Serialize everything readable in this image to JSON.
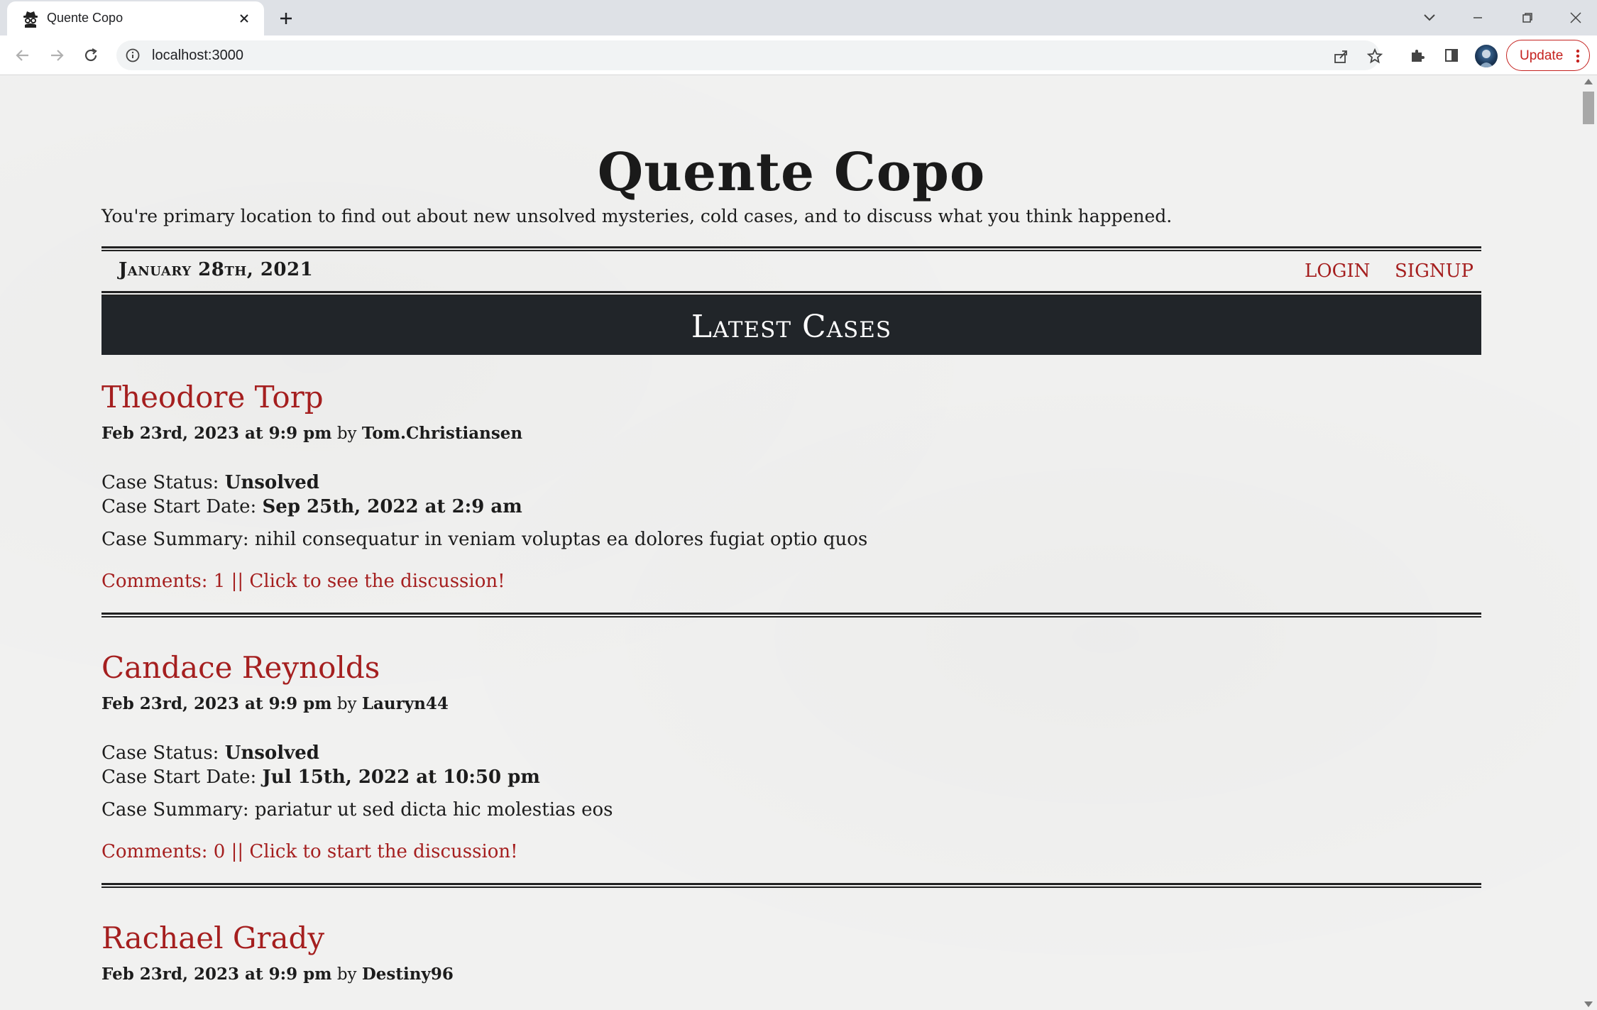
{
  "browser": {
    "tab_title": "Quente Copo",
    "url": "localhost:3000",
    "update_label": "Update"
  },
  "site": {
    "title": "Quente Copo",
    "tagline": "You're primary location to find out about new unsolved mysteries, cold cases, and to discuss what you think happened.",
    "date": "January 28th, 2021",
    "nav": {
      "login": "LOGIN",
      "signup": "SIGNUP"
    },
    "section_title": "Latest Cases"
  },
  "labels": {
    "by": "by",
    "status": "Case Status:",
    "start_date": "Case Start Date:",
    "summary": "Case Summary:"
  },
  "cases": [
    {
      "title": "Theodore Torp",
      "posted": "Feb 23rd, 2023 at 9:9 pm",
      "author": "Tom.Christiansen",
      "status": "Unsolved",
      "start_date": "Sep 25th, 2022 at 2:9 am",
      "summary": "nihil consequatur in veniam voluptas ea dolores fugiat optio quos",
      "comments": "Comments: 1 || Click to see the discussion!"
    },
    {
      "title": "Candace Reynolds",
      "posted": "Feb 23rd, 2023 at 9:9 pm",
      "author": "Lauryn44",
      "status": "Unsolved",
      "start_date": "Jul 15th, 2022 at 10:50 pm",
      "summary": "pariatur ut sed dicta hic molestias eos",
      "comments": "Comments: 0 || Click to start the discussion!"
    },
    {
      "title": "Rachael Grady",
      "posted": "Feb 23rd, 2023 at 9:9 pm",
      "author": "Destiny96"
    }
  ],
  "colors": {
    "accent_red": "#a51f1f",
    "banner_bg": "#212529",
    "page_bg": "#f1f1f0"
  }
}
